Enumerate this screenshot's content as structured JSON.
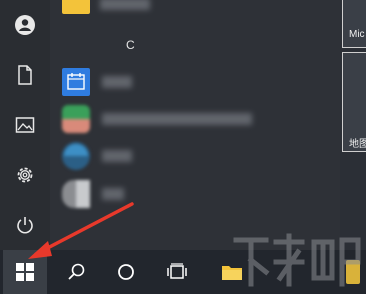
{
  "start_menu": {
    "rail": {
      "items": [
        {
          "name": "user-avatar",
          "icon": "user-icon"
        },
        {
          "name": "documents",
          "icon": "document-icon"
        },
        {
          "name": "pictures",
          "icon": "image-icon"
        },
        {
          "name": "settings",
          "icon": "gear-icon"
        },
        {
          "name": "power",
          "icon": "power-icon"
        }
      ]
    },
    "app_list": {
      "section_header": "C"
    },
    "tiles": {
      "tile_1_label": "Mic",
      "tile_2_label": "地图"
    }
  },
  "taskbar": {
    "start_icon": "windows-logo-icon",
    "search_icon": "search-icon",
    "cortana_icon": "circle-icon",
    "task_view_icon": "task-view-icon",
    "explorer_icon": "folder-icon"
  },
  "annotation": {
    "arrow_color": "#e8392b"
  },
  "colors": {
    "accent_blue": "#2f7ce0",
    "folder_yellow": "#f3c33a",
    "app_green": "#3aa05a"
  }
}
